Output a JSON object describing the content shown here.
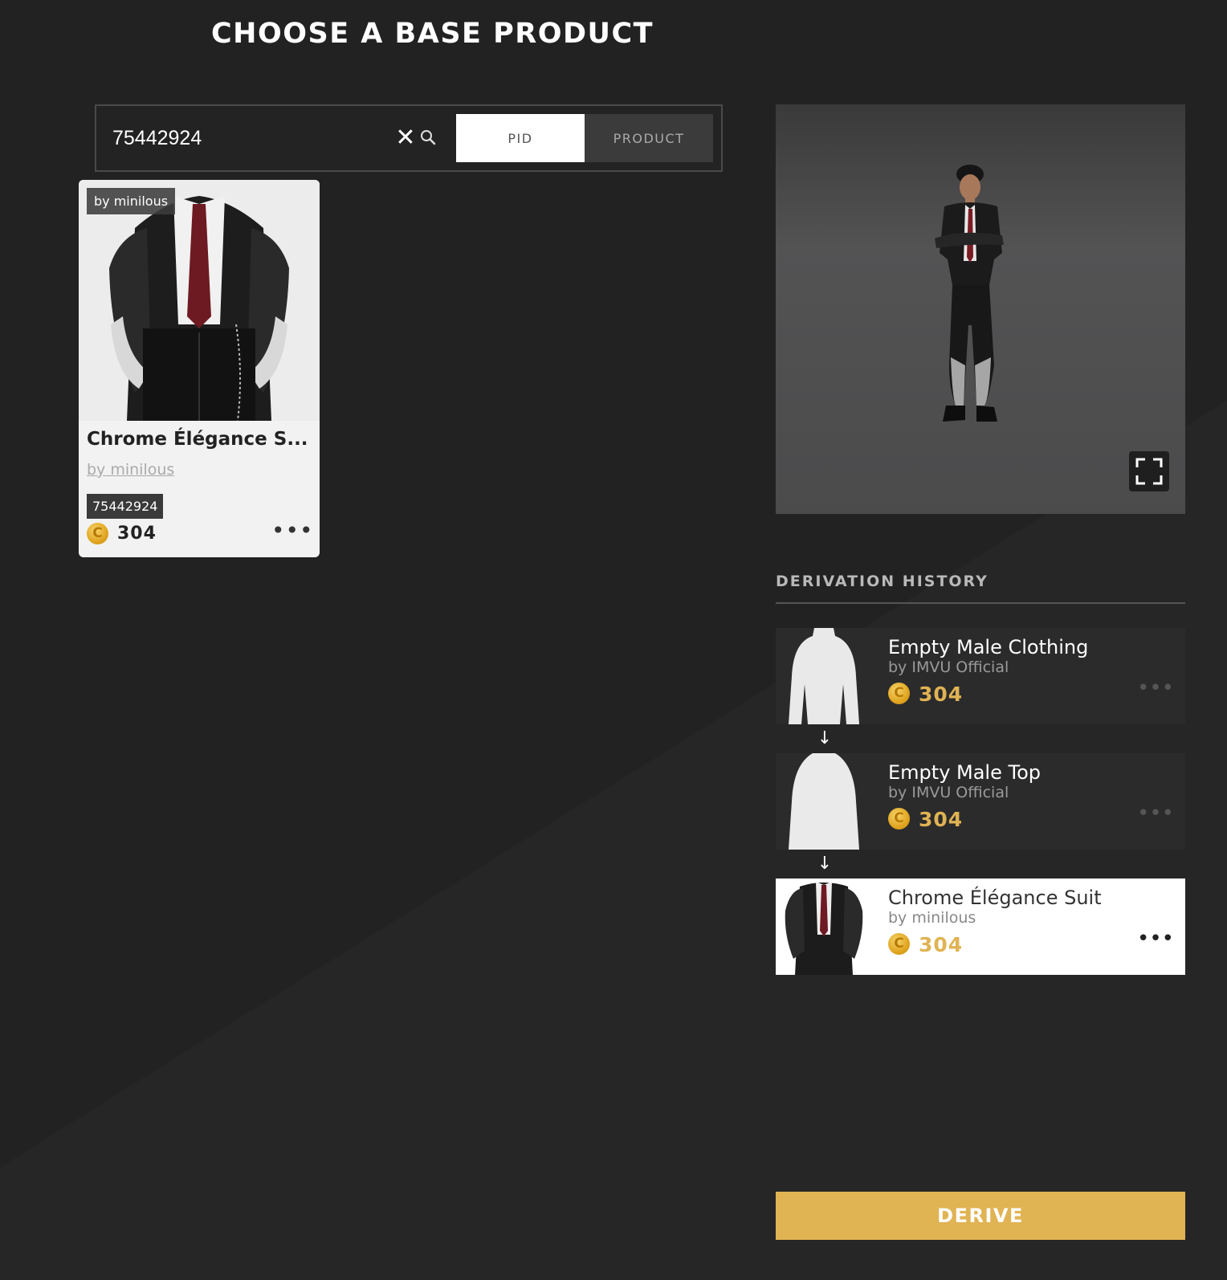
{
  "page": {
    "title": "CHOOSE A BASE PRODUCT"
  },
  "search": {
    "value": "75442924",
    "clear_icon": "close-icon",
    "search_icon": "search-icon",
    "tabs": [
      {
        "label": "PID",
        "active": true
      },
      {
        "label": "PRODUCT",
        "active": false
      }
    ]
  },
  "result_card": {
    "creator_badge": "by minilous",
    "name": "Chrome Élégance S...",
    "creator_link": "by minilous",
    "pid": "75442924",
    "price": "304",
    "coin_symbol": "C",
    "more": "•••"
  },
  "preview": {
    "fullscreen_icon": "fullscreen-icon"
  },
  "history": {
    "heading": "DERIVATION HISTORY",
    "arrow": "↓",
    "items": [
      {
        "name": "Empty Male Clothing",
        "by": "by IMVU Official",
        "price": "304",
        "more": "•••",
        "selected": false
      },
      {
        "name": "Empty Male Top",
        "by": "by IMVU Official",
        "price": "304",
        "more": "•••",
        "selected": false
      },
      {
        "name": "Chrome Élégance Suit",
        "by": "by minilous",
        "price": "304",
        "more": "•••",
        "selected": true
      }
    ]
  },
  "derive_button": {
    "label": "DERIVE"
  },
  "colors": {
    "background": "#222223",
    "accent_gold": "#e0b353",
    "card_bg": "#f2f2f2",
    "history_bg": "#2b2b2c",
    "selected_bg": "#ffffff"
  }
}
